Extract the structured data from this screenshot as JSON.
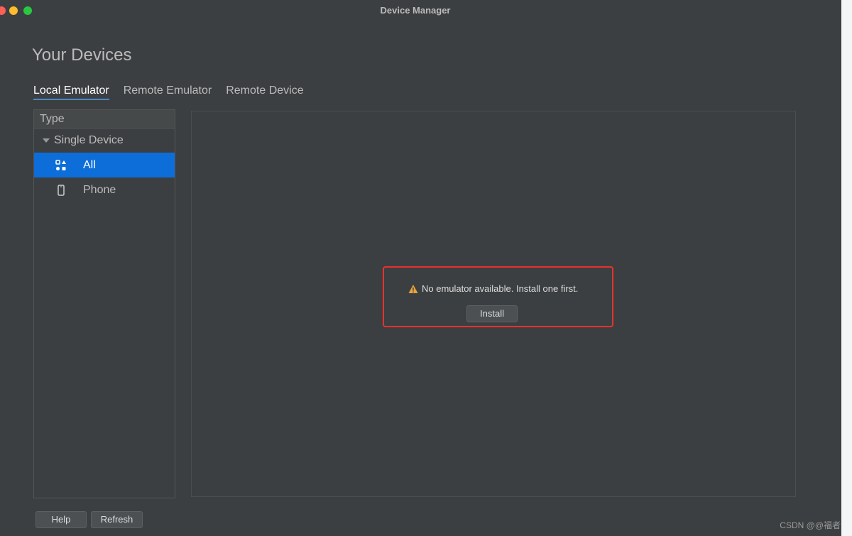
{
  "window": {
    "title": "Device Manager"
  },
  "page": {
    "title": "Your Devices"
  },
  "tabs": [
    {
      "label": "Local Emulator",
      "active": true
    },
    {
      "label": "Remote Emulator",
      "active": false
    },
    {
      "label": "Remote Device",
      "active": false
    }
  ],
  "sidebar": {
    "header": "Type",
    "group": {
      "label": "Single Device",
      "expanded": true
    },
    "items": [
      {
        "label": "All",
        "icon": "grid-shapes-icon",
        "selected": true
      },
      {
        "label": "Phone",
        "icon": "phone-icon",
        "selected": false
      }
    ]
  },
  "content": {
    "message": "No emulator available. Install one first.",
    "message_icon": "warning-icon",
    "install_label": "Install"
  },
  "footer": {
    "help_label": "Help",
    "refresh_label": "Refresh"
  },
  "watermark": "CSDN @@福者",
  "colors": {
    "background": "#3c3f41",
    "selection": "#0d6ed9",
    "highlight_border": "#e8322c",
    "warning": "#e8a33d"
  }
}
